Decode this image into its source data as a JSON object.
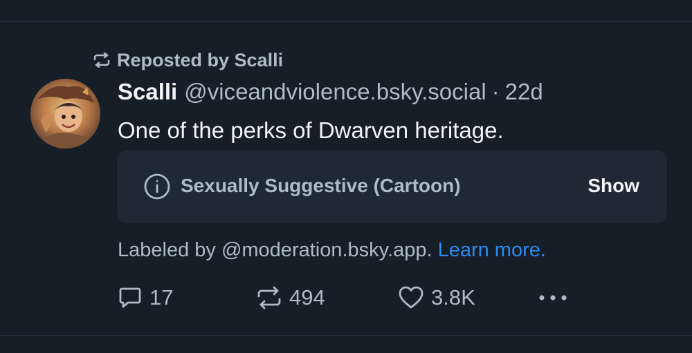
{
  "repost": {
    "text": "Reposted by Scalli",
    "icon": "repost-icon"
  },
  "author": {
    "display_name": "Scalli",
    "handle": "@viceandviolence.bsky.social",
    "separator": "·",
    "timestamp": "22d"
  },
  "post": {
    "text": "One of the perks of Dwarven heritage."
  },
  "content_warning": {
    "icon": "info-circle-icon",
    "label": "Sexually Suggestive (Cartoon)",
    "show_label": "Show"
  },
  "moderation": {
    "prefix": "Labeled by @moderation.bsky.app.",
    "link": "Learn more."
  },
  "actions": {
    "reply_count": "17",
    "repost_count": "494",
    "like_count": "3.8K"
  },
  "colors": {
    "background": "#161e27",
    "muted_text": "#aebbc9",
    "primary_text": "#f1f3f5",
    "link": "#2c8bf0",
    "card": "#1f2935"
  }
}
